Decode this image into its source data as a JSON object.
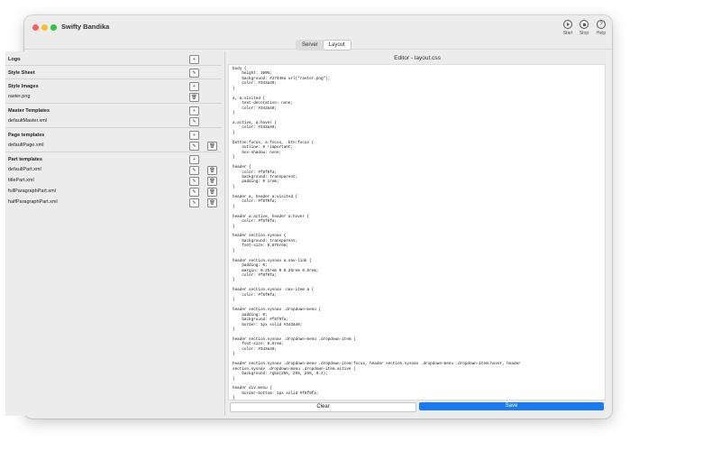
{
  "app": {
    "title": "Swifty Bandika"
  },
  "toolbar": {
    "start_label": "Start",
    "stop_label": "Stop",
    "help_label": "Help"
  },
  "tabs": {
    "server_label": "Server",
    "layout_label": "Layout",
    "active": "Layout"
  },
  "sidebar": {
    "logo": {
      "label": "Logo"
    },
    "style_sheet": {
      "label": "Style Sheet"
    },
    "style_images": {
      "label": "Style Images",
      "items": [
        {
          "label": "raster.png"
        }
      ]
    },
    "master_templates": {
      "label": "Master Templates",
      "items": [
        {
          "label": "defaultMaster.xml"
        }
      ]
    },
    "page_templates": {
      "label": "Page templates",
      "items": [
        {
          "label": "defaultPage.xml"
        }
      ]
    },
    "part_templates": {
      "label": "Part templates",
      "items": [
        {
          "label": "defaultPart.xml"
        },
        {
          "label": "titlePart.xml"
        },
        {
          "label": "fullParagraphPart.xml"
        },
        {
          "label": "halfParagraphPart.xml"
        }
      ]
    }
  },
  "editor": {
    "title": "Editor - layout.css",
    "content": "body {\n    height: 100%;\n    background: #27446a url(\"raster.png\");\n    color: #343a40;\n}\n\na, a:visited {\n    text-decoration: none;\n    color: #343a40;\n}\n\na:active, a:hover {\n    color: #343a40;\n}\n\nbutton:focus, a:focus, .btn:focus {\n    outline: 0 !important;\n    box-shadow: none;\n}\n\nheader {\n    color: #f8f9fa;\n    background: transparent;\n    padding: 0 1rem;\n}\n\nheader a, header a:visited {\n    color: #f8f9fa;\n}\n\nheader a:active, header a:hover {\n    color: #f8f9fa;\n}\n\nheader section.sysnav {\n    background: transparent;\n    font-size: 0.875rem;\n}\n\nheader section.sysnav a.nav-link {\n    padding: 0;\n    margin: 0.25rem 0 0.25rem 0.5rem;\n    color: #f8f9fa;\n}\n\nheader section.sysnav .nav-item a {\n    color: #f8f9fa;\n}\n\nheader section.sysnav .dropdown-menu {\n    padding: 0;\n    background: #f8f9fa;\n    border: 1px solid #343a40;\n}\n\nheader section.sysnav .dropdown-menu .dropdown-item {\n    font-size: 0.8rem;\n    color: #343a40;\n}\n\nheader section.sysnav .dropdown-menu .dropdown-item:focus, header section.sysnav .dropdown-menu .dropdown-item:hover, header\nsection.sysnav .dropdown-menu .dropdown-item.active {\n    background: rgba(255, 255, 255, 0.2);\n}\n\nheader div.menu {\n    border-bottom: 1px solid #f8f9fa;\n}",
    "clear_label": "Clear",
    "save_label": "Save"
  },
  "colors": {
    "accent": "#1a7bf2",
    "close": "#fe5f57",
    "minimize": "#febc2e",
    "zoom": "#28c840"
  },
  "icons": {
    "add": "plus-square-icon",
    "edit": "pencil-square-icon",
    "delete": "trash-icon",
    "start": "play-circle-icon",
    "stop": "stop-circle-icon",
    "help": "question-circle-icon"
  }
}
